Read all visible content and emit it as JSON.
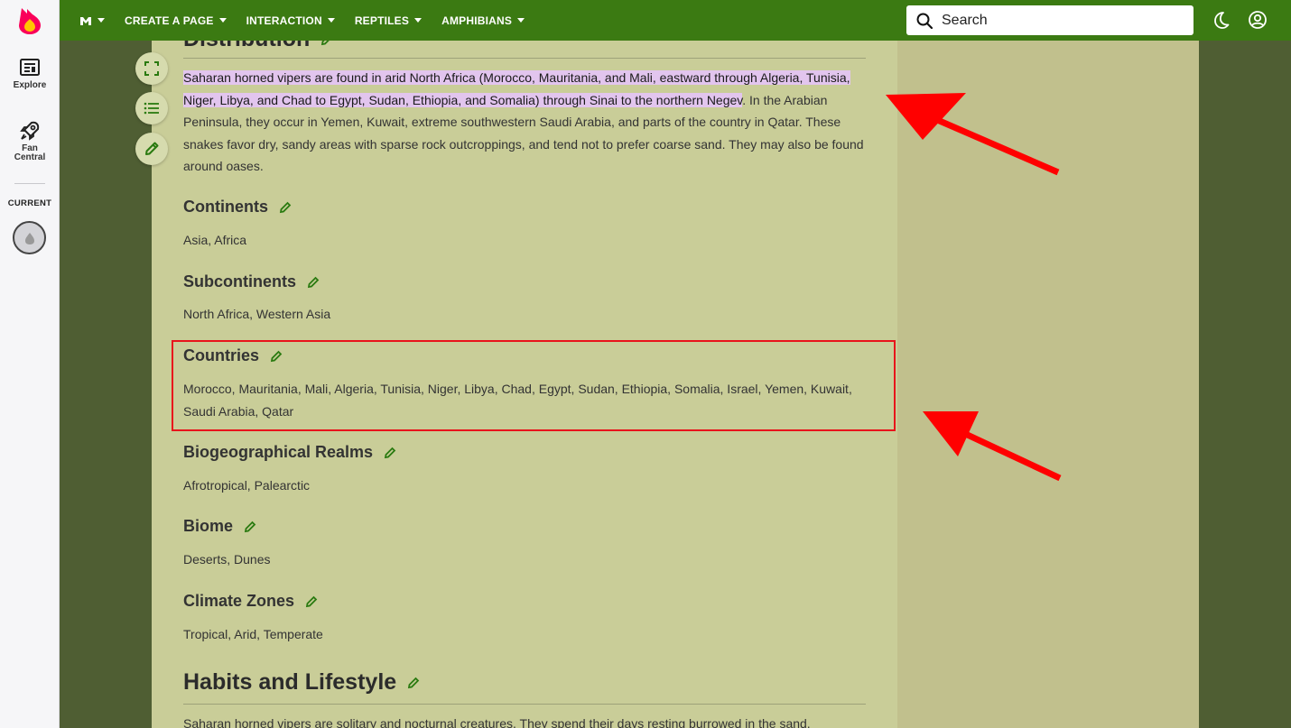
{
  "rail": {
    "explore_label": "Explore",
    "fan_central_line1": "Fan",
    "fan_central_line2": "Central",
    "current_label": "CURRENT"
  },
  "topbar": {
    "nav_items": [
      "CREATE A PAGE",
      "INTERACTION",
      "REPTILES",
      "AMPHIBIANS"
    ],
    "search_placeholder": "Search"
  },
  "article": {
    "distribution_heading": "Distribution",
    "distribution_highlighted": "Saharan horned vipers are found in arid North Africa (Morocco, Mauritania, and Mali, eastward through Algeria, Tunisia, Niger, Libya, and Chad to Egypt, Sudan, Ethiopia, and Somalia) through Sinai to the northern Negev",
    "distribution_rest": ". In the Arabian Peninsula, they occur in Yemen, Kuwait, extreme southwestern Saudi Arabia, and parts of the country in Qatar. These snakes favor dry, sandy areas with sparse rock outcroppings, and tend not to prefer coarse sand. They may also be found around oases.",
    "sections": [
      {
        "title": "Continents",
        "text": "Asia, Africa"
      },
      {
        "title": "Subcontinents",
        "text": "North Africa, Western Asia"
      },
      {
        "title": "Countries",
        "text": "Morocco, Mauritania, Mali, Algeria, Tunisia, Niger, Libya, Chad, Egypt, Sudan, Ethiopia, Somalia, Israel, Yemen, Kuwait, Saudi Arabia, Qatar"
      },
      {
        "title": "Biogeographical Realms",
        "text": "Afrotropical, Palearctic"
      },
      {
        "title": "Biome",
        "text": "Deserts, Dunes"
      },
      {
        "title": "Climate Zones",
        "text": "Tropical, Arid, Temperate"
      }
    ],
    "habits_heading": "Habits and Lifestyle",
    "habits_text": "Saharan horned vipers are solitary and nocturnal creatures. They spend their days resting burrowed in the sand."
  },
  "colors": {
    "topbar": "#3b7a12",
    "content_bg": "#c9cd98",
    "highlight": "#e2c5ee",
    "annotation_red": "#e8141b"
  }
}
